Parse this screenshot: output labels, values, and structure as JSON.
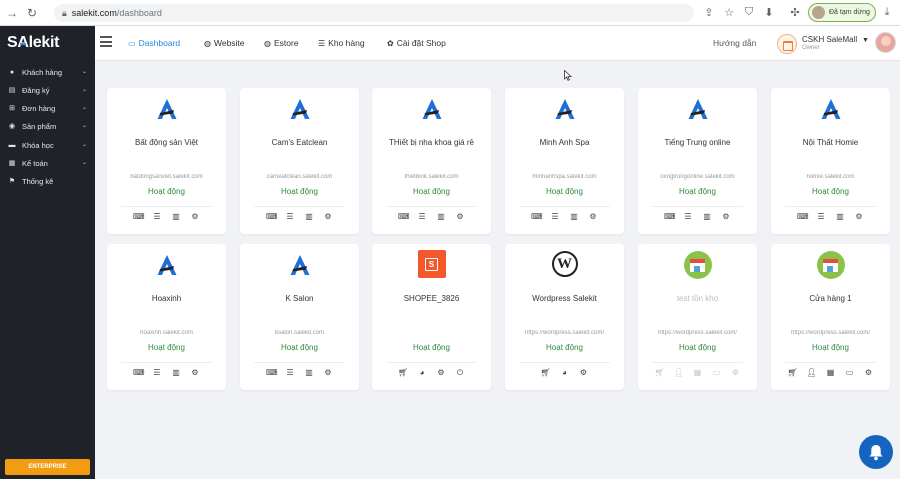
{
  "browser": {
    "url_host": "salekit.com",
    "url_path": "/dashboard",
    "profile_label": "Đã tạm dừng"
  },
  "sidebar": {
    "logo_prefix": "S",
    "logo_a": "A",
    "logo_suffix": "lekit",
    "items": [
      {
        "label": "Khách hàng",
        "icon": "user-icon",
        "has_submenu": true
      },
      {
        "label": "Đăng ký",
        "icon": "wallet-icon",
        "has_submenu": true
      },
      {
        "label": "Đơn hàng",
        "icon": "cart-icon",
        "has_submenu": true
      },
      {
        "label": "Sản phẩm",
        "icon": "cube-icon",
        "has_submenu": true
      },
      {
        "label": "Khóa học",
        "icon": "graduation-icon",
        "has_submenu": true
      },
      {
        "label": "Kế toán",
        "icon": "calculator-icon",
        "has_submenu": true
      },
      {
        "label": "Thống kê",
        "icon": "flag-icon",
        "has_submenu": false
      }
    ],
    "enterprise_label": "ENTERPRISE"
  },
  "topnav": {
    "items": [
      {
        "label": "Dashboard",
        "icon": "monitor-icon",
        "active": true
      },
      {
        "label": "Website",
        "icon": "globe-icon",
        "active": false
      },
      {
        "label": "Estore",
        "icon": "globe-icon",
        "active": false
      },
      {
        "label": "Kho hàng",
        "icon": "database-icon",
        "active": false
      },
      {
        "label": "Cài đặt Shop",
        "icon": "gear-icon",
        "active": false
      }
    ],
    "guide_label": "Hướng dẫn",
    "user_name": "CSKH SaleMall",
    "user_role": "Owner"
  },
  "colors": {
    "accent": "#1e88e5",
    "status_active": "#2e8b3a",
    "sidebar_bg": "#1f2329",
    "enterprise": "#f39c12"
  },
  "shops": [
    {
      "name": "Bất động sản Việt",
      "domain": "batdongsanviet.salekit.com",
      "status": "Hoạt động",
      "logo": "salekit-logo",
      "actions": [
        "keyboard-icon",
        "list-icon",
        "columns-icon",
        "gear-icon"
      ]
    },
    {
      "name": "Cam's Eatclean",
      "domain": "cameatclean.salekit.com",
      "status": "Hoạt động",
      "logo": "salekit-logo",
      "actions": [
        "keyboard-icon",
        "list-icon",
        "columns-icon",
        "gear-icon"
      ]
    },
    {
      "name": "THiết bị nha khoa giá rẻ",
      "domain": "thietbink.salekit.com",
      "status": "Hoạt động",
      "logo": "salekit-logo",
      "actions": [
        "keyboard-icon",
        "list-icon",
        "columns-icon",
        "gear-icon"
      ]
    },
    {
      "name": "Minh Anh Spa",
      "domain": "minhanhspa.salekit.com",
      "status": "Hoạt động",
      "logo": "salekit-logo",
      "actions": [
        "keyboard-icon",
        "list-icon",
        "columns-icon",
        "gear-icon"
      ]
    },
    {
      "name": "Tiếng Trung online",
      "domain": "oxngtrungonline.salekit.com",
      "status": "Hoạt động",
      "logo": "salekit-logo",
      "actions": [
        "keyboard-icon",
        "list-icon",
        "columns-icon",
        "gear-icon"
      ]
    },
    {
      "name": "Nội Thất Homie",
      "domain": "homie.salekit.com",
      "status": "Hoạt động",
      "logo": "salekit-logo",
      "actions": [
        "keyboard-icon",
        "list-icon",
        "columns-icon",
        "gear-icon"
      ]
    },
    {
      "name": "Hoaxinh",
      "domain": "hoaxinh.salekit.com",
      "status": "Hoạt động",
      "logo": "salekit-logo",
      "actions": [
        "keyboard-icon",
        "list-icon",
        "columns-icon",
        "gear-icon"
      ]
    },
    {
      "name": "K Salon",
      "domain": "ksalon.salekit.com",
      "status": "Hoạt động",
      "logo": "salekit-logo",
      "actions": [
        "keyboard-icon",
        "list-icon",
        "columns-icon",
        "gear-icon"
      ]
    },
    {
      "name": "SHOPEE_3826",
      "domain": "",
      "status": "Hoạt động",
      "logo": "shopee-logo",
      "actions": [
        "cart-icon",
        "sync-icon",
        "gear-icon",
        "power-icon"
      ]
    },
    {
      "name": "Wordpress Salekit",
      "domain": "https://wordpress.salekit.com/",
      "status": "Hoạt động",
      "logo": "wordpress-logo",
      "actions": [
        "cart-icon",
        "sync-icon",
        "gear-icon"
      ]
    },
    {
      "name": "test tồn kho",
      "domain": "https://wordpress.salekit.com/",
      "status": "Hoạt động",
      "logo": "store-logo",
      "muted": true,
      "actions": [
        "cart-icon",
        "user-icon",
        "calendar-icon",
        "card-icon",
        "gear-icon"
      ]
    },
    {
      "name": "Cửa hàng 1",
      "domain": "https://wordpress.salekit.com/",
      "status": "Hoạt động",
      "logo": "store-logo",
      "actions": [
        "cart-icon",
        "user-icon",
        "calendar-icon",
        "card-icon",
        "gear-icon"
      ]
    }
  ]
}
